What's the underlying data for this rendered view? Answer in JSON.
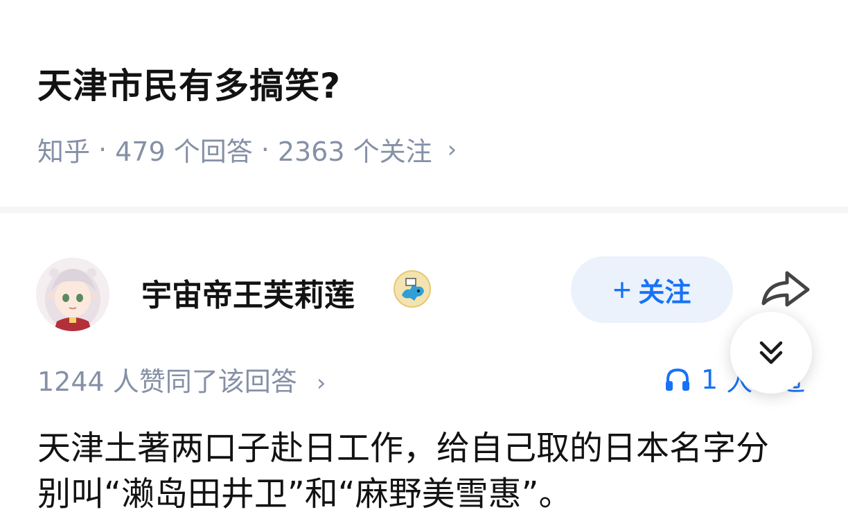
{
  "question": {
    "title": "天津市民有多搞笑?",
    "source": "知乎",
    "answers_count": "479 个回答",
    "followers_count": "2363 个关注",
    "meta_separator": "·",
    "chevron": "›"
  },
  "answer": {
    "author": {
      "name": "宇宙帝王芙莉莲",
      "avatar_icon": "anime-girl-avatar",
      "badge_icon": "cartoon-badge-icon"
    },
    "follow_button": {
      "label": "关注",
      "icon": "plus-icon"
    },
    "share_icon": "share-arrow-icon",
    "upvote_text": "1244 人赞同了该回答",
    "listen": {
      "icon": "headphones-icon",
      "count": "1",
      "suffix": "人…过"
    },
    "collapse_icon": "double-chevron-down-icon",
    "content": "天津土著两口子赴日工作，给自己取的日本名字分别叫“濑岛田井卫”和“麻野美雪惠”。"
  },
  "colors": {
    "accent": "#1772f6",
    "follow_bg": "#ebf2fc",
    "meta_text": "#8590a6",
    "title_text": "#121212"
  }
}
